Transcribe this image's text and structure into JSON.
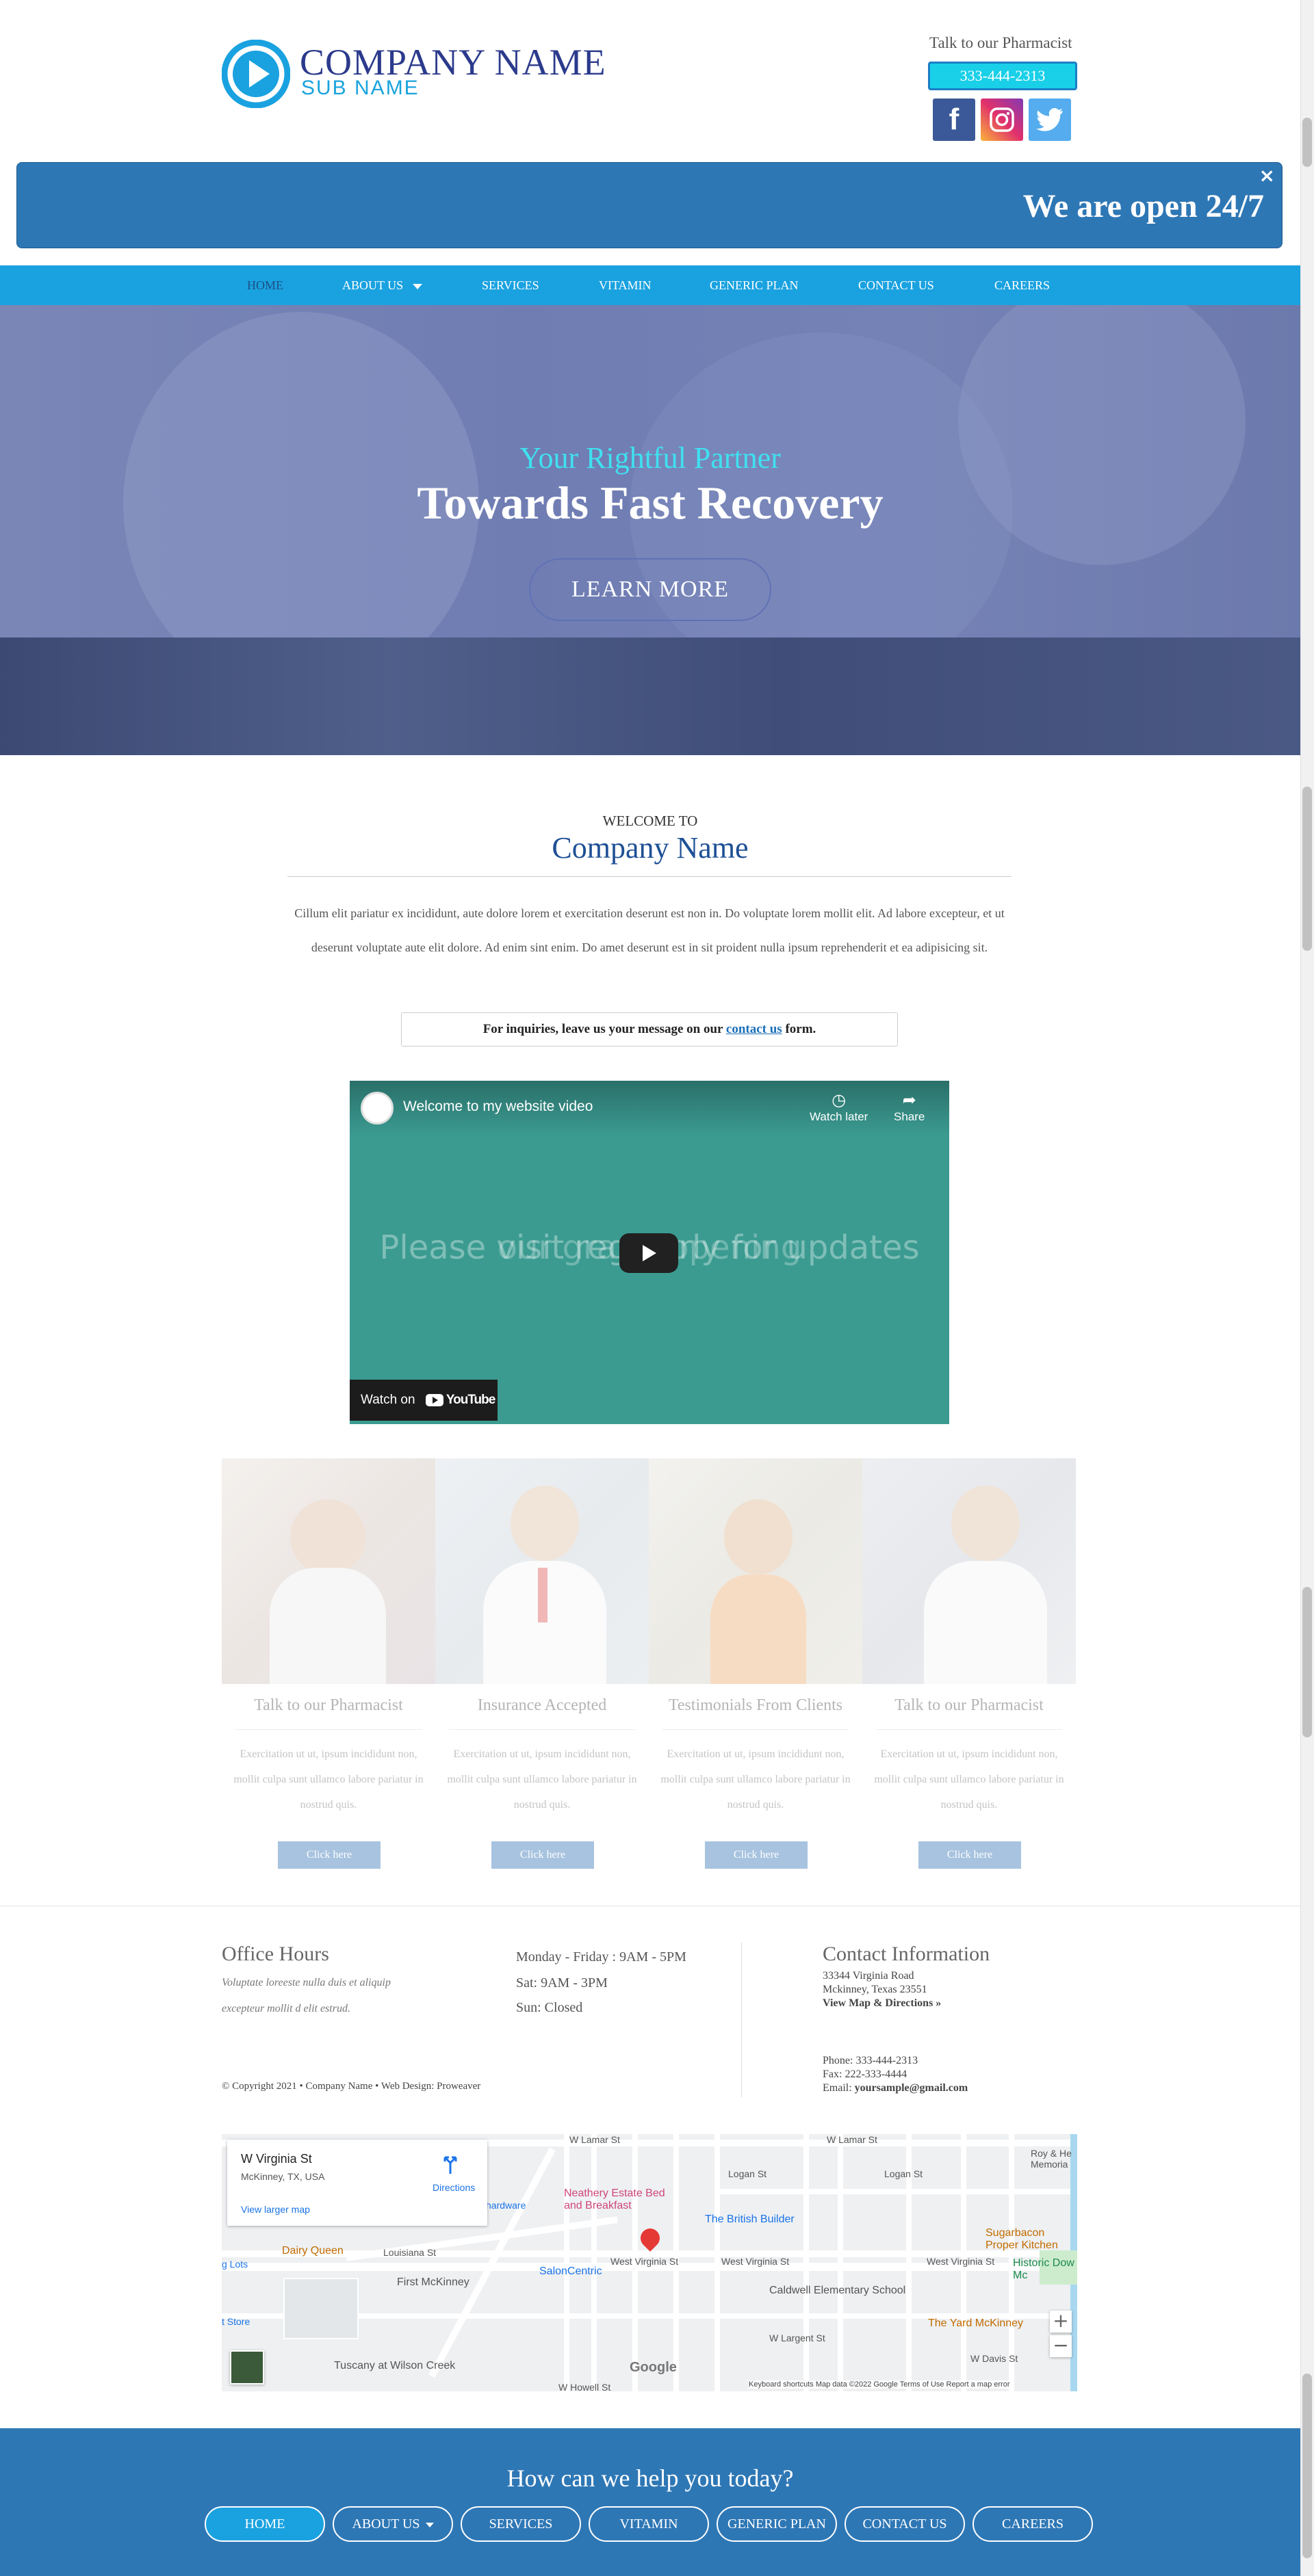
{
  "header": {
    "company_name": "COMPANY NAME",
    "sub_name": "SUB NAME",
    "talk_label": "Talk to our Pharmacist",
    "phone": "333-444-2313",
    "social": {
      "facebook": "f",
      "twitter": "t"
    }
  },
  "banner": {
    "text": "We are open 24/7",
    "close": "×"
  },
  "nav": {
    "items": [
      "HOME",
      "ABOUT US",
      "SERVICES",
      "VITAMIN",
      "GENERIC PLAN",
      "CONTACT US",
      "CAREERS"
    ]
  },
  "hero": {
    "subtitle": "Your Rightful Partner",
    "title": "Towards Fast Recovery",
    "cta": "LEARN MORE"
  },
  "welcome": {
    "pre": "WELCOME TO",
    "name": "Company Name",
    "text": "Cillum elit pariatur ex incididunt, aute dolore lorem et exercitation deserunt est non in. Do voluptate lorem mollit elit. Ad labore excepteur, et ut deserunt voluptate aute elit dolore. Ad enim sint enim. Do amet deserunt est in sit proident nulla ipsum reprehenderit et ea adipisicing sit.",
    "inquiry_before": "For inquiries, leave us your message on our ",
    "inquiry_link": "contact us",
    "inquiry_after": " form."
  },
  "video": {
    "title": "Welcome to my website video",
    "watch_later": "Watch later",
    "share": "Share",
    "overlay_1": "Please visit regularly for updates",
    "overlay_2": "our grand opening",
    "watch_on": "Watch on",
    "youtube": "YouTube"
  },
  "features": [
    {
      "title": "Talk to our Pharmacist",
      "text": "Exercitation ut ut, ipsum incididunt non, mollit culpa sunt ullamco labore pariatur in nostrud quis.",
      "button": "Click here"
    },
    {
      "title": "Insurance Accepted",
      "text": "Exercitation ut ut, ipsum incididunt non, mollit culpa sunt ullamco labore pariatur in nostrud quis.",
      "button": "Click here"
    },
    {
      "title": "Testimonials From Clients",
      "text": "Exercitation ut ut, ipsum incididunt non, mollit culpa sunt ullamco labore pariatur in nostrud quis.",
      "button": "Click here"
    },
    {
      "title": "Talk to our Pharmacist",
      "text": "Exercitation ut ut, ipsum incididunt non, mollit culpa sunt ullamco labore pariatur in nostrud quis.",
      "button": "Click here"
    }
  ],
  "office": {
    "title": "Office Hours",
    "note": "Voluptate loreeste nulla duis et aliquip excepteur mollit d elit estrud.",
    "hours": [
      "Monday - Friday : 9AM - 5PM",
      "Sat: 9AM - 3PM",
      "Sun: Closed"
    ],
    "copyright": "© Copyright 2021 • Company Name • Web Design: Proweaver"
  },
  "contact": {
    "title": "Contact Information",
    "address1": "33344 Virginia Road",
    "address2": "Mckinney, Texas 23551",
    "map_link": "View Map & Directions »",
    "phone": "Phone: 333-444-2313",
    "fax": "Fax: 222-333-4444",
    "email_label": "Email: ",
    "email": "yoursample@gmail.com"
  },
  "map": {
    "place": "W Virginia St",
    "place_sub": "McKinney, TX, USA",
    "larger": "View larger map",
    "directions": "Directions",
    "streets": {
      "lamar1": "W Lamar St",
      "lamar2": "W Lamar St",
      "logan1": "Logan St",
      "logan2": "Logan St",
      "louisiana": "Louisiana St",
      "virginia1": "West Virginia St",
      "virginia2": "West Virginia St",
      "virginia3": "West Virginia St",
      "largent": "W Largent St",
      "davis": "W Davis St",
      "howell": "W Howell St"
    },
    "pois": {
      "neathery": "Neathery Estate Bed and Breakfast",
      "british": "The British Builder",
      "dairy": "Dairy Queen",
      "salon": "SalonCentric",
      "firstmckinney": "First McKinney",
      "caldwell": "Caldwell Elementary School",
      "yard": "The Yard McKinney",
      "sugarbacon": "Sugarbacon Proper Kitchen",
      "historic": "Historic Dow Mc",
      "tuscany": "Tuscany at Wilson Creek",
      "roy": "Roy & He Memoria",
      "hardware": "hardware",
      "lots": "g Lots",
      "store": "t Store"
    },
    "zoom_in": "+",
    "zoom_out": "−",
    "google": "Google",
    "footer": "Keyboard shortcuts     Map data ©2022 Google     Terms of Use     Report a map error"
  },
  "footer": {
    "question": "How can we help you today?",
    "items": [
      "HOME",
      "ABOUT US",
      "SERVICES",
      "VITAMIN",
      "GENERIC PLAN",
      "CONTACT US",
      "CAREERS"
    ]
  },
  "colors": {
    "brand_blue": "#2e77b5",
    "nav_blue": "#1aa2e0",
    "accent_cyan": "#3fe1f0",
    "dark_navy": "#2b3a8c"
  }
}
